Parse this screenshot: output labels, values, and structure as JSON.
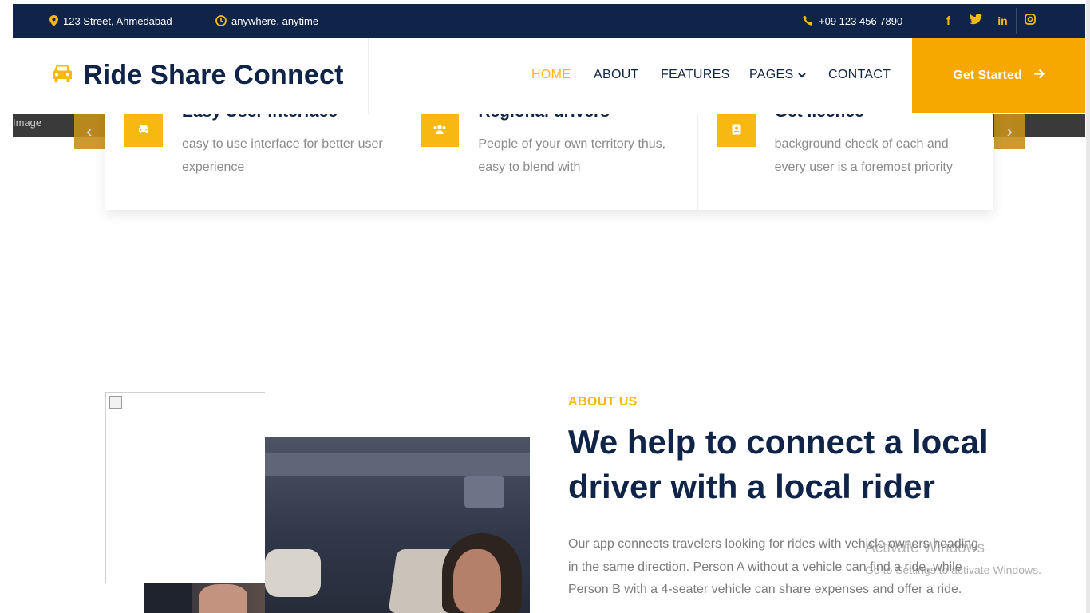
{
  "topbar": {
    "address": "123 Street, Ahmedabad",
    "hours": "anywhere, anytime",
    "phone": "+09 123 456 7890",
    "socials": [
      {
        "name": "facebook",
        "glyph": "f"
      },
      {
        "name": "twitter",
        "glyph": "🐦"
      },
      {
        "name": "linkedin",
        "glyph": "in"
      },
      {
        "name": "instagram",
        "glyph": "◎"
      }
    ]
  },
  "nav": {
    "brand": "Ride Share Connect",
    "links": [
      "HOME",
      "ABOUT",
      "FEATURES",
      "PAGES",
      "CONTACT"
    ],
    "active": "HOME",
    "cta": "Get Started"
  },
  "carousel": {
    "broken_image_alt": "Image",
    "prev_glyph": "‹",
    "next_glyph": "›"
  },
  "features": [
    {
      "title": "Easy User Interface",
      "description": "easy to use interface for better user experience",
      "icon": "car-icon"
    },
    {
      "title": "Regional drivers",
      "description": "People of your own territory thus, easy to blend with",
      "icon": "users-icon"
    },
    {
      "title": "Get licence",
      "description": "background check of each and every user is a foremost priority",
      "icon": "id-card-icon"
    }
  ],
  "about": {
    "eyebrow": "ABOUT US",
    "title": "We help to connect a local driver with a local rider",
    "text": "Our app connects travelers looking for rides with vehicle owners heading in the same direction. Person A without a vehicle can find a ride, while Person B with a 4-seater vehicle can share expenses and offer a ride."
  },
  "watermark": {
    "line1": "Activate Windows",
    "line2": "Go to Settings to activate Windows."
  },
  "colors": {
    "navy": "#0f2448",
    "accent": "#f7b90f",
    "cta": "#f7a800"
  }
}
